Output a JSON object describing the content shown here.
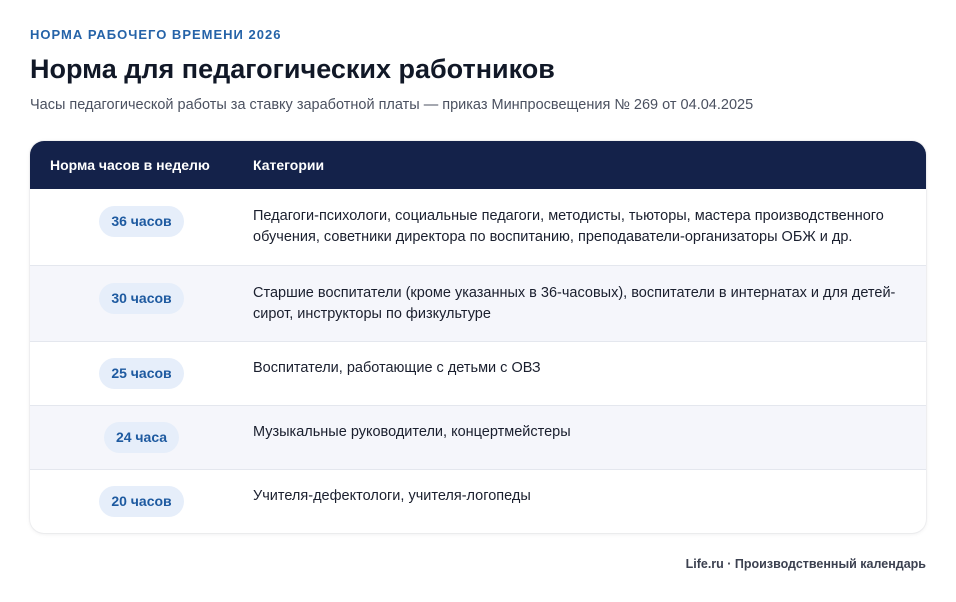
{
  "header": {
    "kicker": "НОРМА РАБОЧЕГО ВРЕМЕНИ 2026",
    "title": "Норма для педагогических работников",
    "subtitle": "Часы педагогической работы за ставку заработной платы — приказ Минпросвещения № 269 от 04.04.2025"
  },
  "table": {
    "columns": [
      "Норма часов в неделю",
      "Категории"
    ],
    "rows": [
      {
        "hours": "36 часов",
        "category": "Педагоги-психологи, социальные педагоги, методисты, тьюторы, мастера производственного обучения, советники директора по воспитанию, преподаватели-организаторы ОБЖ и др."
      },
      {
        "hours": "30 часов",
        "category": "Старшие воспитатели (кроме указанных в 36-часовых), воспитатели в интернатах и для детей-сирот, инструкторы по физкультуре"
      },
      {
        "hours": "25 часов",
        "category": "Воспитатели, работающие с детьми с ОВЗ"
      },
      {
        "hours": "24 часа",
        "category": "Музыкальные руководители, концертмейстеры"
      },
      {
        "hours": "20 часов",
        "category": "Учителя-дефектологи, учителя-логопеды"
      }
    ]
  },
  "footer": {
    "source": "Life.ru · Производственный календарь"
  },
  "colors": {
    "accent": "#2563a8",
    "header_bg": "#14224a",
    "pill_bg": "#e6eefa",
    "pill_text": "#1e5aa0",
    "row_alt": "#f5f6fb"
  }
}
